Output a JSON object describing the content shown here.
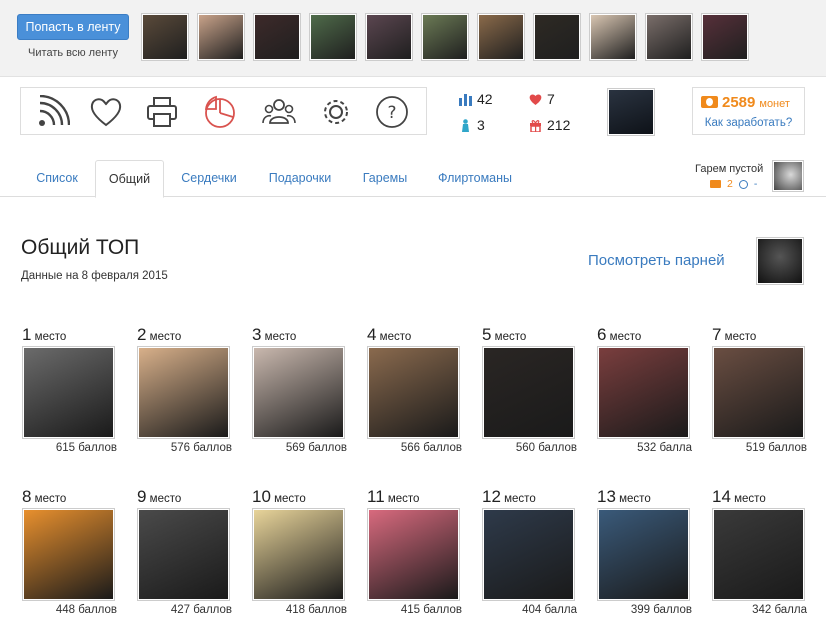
{
  "feed": {
    "join_button": "Попасть в ленту",
    "read_link": "Читать всю ленту",
    "thumbs": [
      "#5a4a3a",
      "#c9a38a",
      "#3d2a2a",
      "#4f6b4a",
      "#5b4650",
      "#6b7a55",
      "#8a6a4a",
      "#2e2a24",
      "#d9c6b2",
      "#7a6e6a",
      "#57303a"
    ]
  },
  "toolbar": {
    "icons": [
      "rss-icon",
      "heart-icon",
      "printer-icon",
      "pie-chart-icon",
      "group-icon",
      "gear-icon",
      "help-icon"
    ]
  },
  "stats": {
    "rating": "42",
    "hearts": "7",
    "people": "3",
    "gifts": "212"
  },
  "coins": {
    "amount": "2589",
    "unit": "монет",
    "earn_link": "Как заработать?"
  },
  "tabs": [
    {
      "label": "Список"
    },
    {
      "label": "Общий"
    },
    {
      "label": "Сердечки"
    },
    {
      "label": "Подарочки"
    },
    {
      "label": "Гаремы"
    },
    {
      "label": "Флиртоманы"
    }
  ],
  "harem": {
    "status": "Гарем пустой",
    "count": "2",
    "time": "-"
  },
  "top": {
    "title": "Общий ТОП",
    "date": "Данные на 8 февраля 2015",
    "see_boys": "Посмотреть парней",
    "place_word": "место",
    "entries": [
      {
        "place": "1",
        "score": "615 баллов",
        "color": "#6b6b6b"
      },
      {
        "place": "2",
        "score": "576 баллов",
        "color": "#d8b08a"
      },
      {
        "place": "3",
        "score": "569 баллов",
        "color": "#c9b8ae"
      },
      {
        "place": "4",
        "score": "566 баллов",
        "color": "#8a6a4e"
      },
      {
        "place": "5",
        "score": "560 баллов",
        "color": "#2a2624"
      },
      {
        "place": "6",
        "score": "532 балла",
        "color": "#7a3e3e"
      },
      {
        "place": "7",
        "score": "519 баллов",
        "color": "#6a4e42"
      },
      {
        "place": "8",
        "score": "448 баллов",
        "color": "#e8902e"
      },
      {
        "place": "9",
        "score": "427 баллов",
        "color": "#4a4a4a"
      },
      {
        "place": "10",
        "score": "418 баллов",
        "color": "#e8d49a"
      },
      {
        "place": "11",
        "score": "415 баллов",
        "color": "#d86a7e"
      },
      {
        "place": "12",
        "score": "404 балла",
        "color": "#2e3a4a"
      },
      {
        "place": "13",
        "score": "399 баллов",
        "color": "#3a5a7a"
      },
      {
        "place": "14",
        "score": "342 балла",
        "color": "#3a3a3a"
      }
    ]
  }
}
